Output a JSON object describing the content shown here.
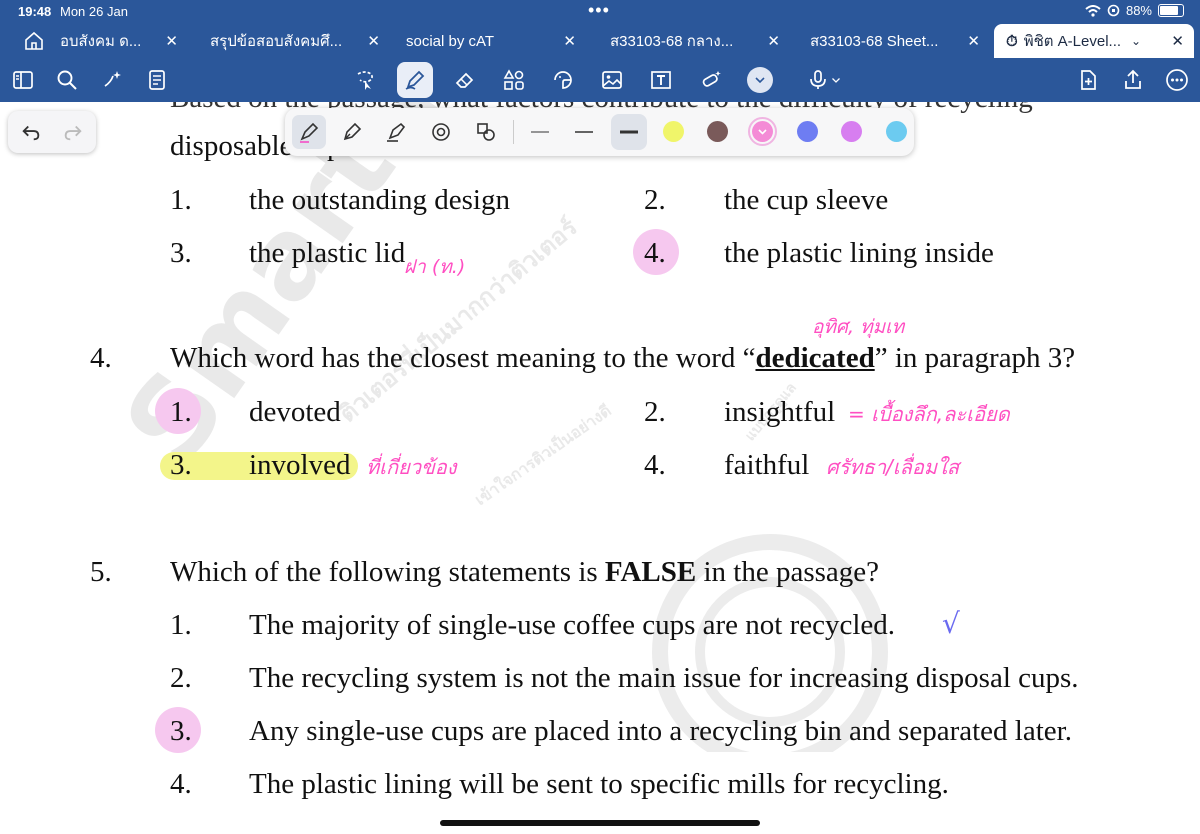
{
  "status_bar": {
    "time": "19:48",
    "date": "Mon 26 Jan",
    "battery": "88%",
    "battery_level": 0.88
  },
  "tabs": [
    {
      "label": "อบสังคม ด...",
      "active": false
    },
    {
      "label": "สรุปข้อสอบสังคมศึ...",
      "active": false
    },
    {
      "label": "social by cAT",
      "active": false
    },
    {
      "label": "ส33103-68 กลาง...",
      "active": false
    },
    {
      "label": "ส33103-68 Sheet...",
      "active": false
    },
    {
      "label": "พิชิต A-Level...",
      "active": true
    }
  ],
  "toolbar_icons": [
    "sidebar-icon",
    "search-icon",
    "sparkle-icon",
    "notes-icon",
    "lasso-icon",
    "pen-tool-icon",
    "eraser-icon",
    "shapes-icon",
    "sticker-icon",
    "image-icon",
    "textbox-icon",
    "tape-icon",
    "more-chevron-icon",
    "mic-icon",
    "add-page-icon",
    "share-icon",
    "more-icon"
  ],
  "pen_panel": {
    "tools": [
      "fineliner-icon",
      "fountain-pen-icon",
      "highlighter-icon",
      "brush-icon",
      "shape-pen-icon"
    ],
    "colors": [
      "#f0f56a",
      "#7a5a5a",
      "#f48bd6",
      "#6e7df2",
      "#d77ef0",
      "#6ccbf0"
    ],
    "selected_color": "#f48bd6"
  },
  "document": {
    "cut_top_line": "Based on the passage, what factors contribute to the difficulty of recycling",
    "q3": {
      "line2": "disposable cups?",
      "options": [
        {
          "num": "1.",
          "text": "the outstanding design"
        },
        {
          "num": "2.",
          "text": "the cup sleeve"
        },
        {
          "num": "3.",
          "text": "the plastic lid"
        },
        {
          "num": "4.",
          "text": "the plastic lining inside"
        }
      ],
      "note_lid": "ฝา (ท.)"
    },
    "q4": {
      "num": "4.",
      "pre": "Which word has the closest meaning to the word “",
      "keyword": "dedicated",
      "post": "” in paragraph 3?",
      "options": [
        {
          "num": "1.",
          "text": "devoted"
        },
        {
          "num": "2.",
          "text": "insightful"
        },
        {
          "num": "3.",
          "text": "involved"
        },
        {
          "num": "4.",
          "text": "faithful"
        }
      ],
      "note_keyword": "อุทิศ, ทุ่มเท",
      "note_insightful": "= เบื้องลึก,ละเอียด",
      "note_involved": "ที่เกี่ยวข้อง",
      "note_faithful": "ศรัทธา/เลื่อมใส"
    },
    "q5": {
      "num": "5.",
      "pre": "Which of the following statements is ",
      "keyword": "FALSE",
      "post": " in the passage?",
      "options": [
        {
          "num": "1.",
          "text": "The majority of single-use coffee cups are not recycled."
        },
        {
          "num": "2.",
          "text": "The recycling system is not the main issue for increasing disposal cups."
        },
        {
          "num": "3.",
          "text": "Any single-use cups are placed into a recycling bin and separated later."
        },
        {
          "num": "4.",
          "text": "The plastic lining will be sent to specific mills for recycling."
        }
      ],
      "check_mark": "√"
    },
    "watermark": {
      "brand": "Smart Me",
      "thai1": "ติวเตอร์ที่เป็นมากกว่าติวเตอร์",
      "thai2": "เข้าใจการติวเป็นอย่างดี",
      "thai3": "แบบครูดูแล"
    }
  }
}
